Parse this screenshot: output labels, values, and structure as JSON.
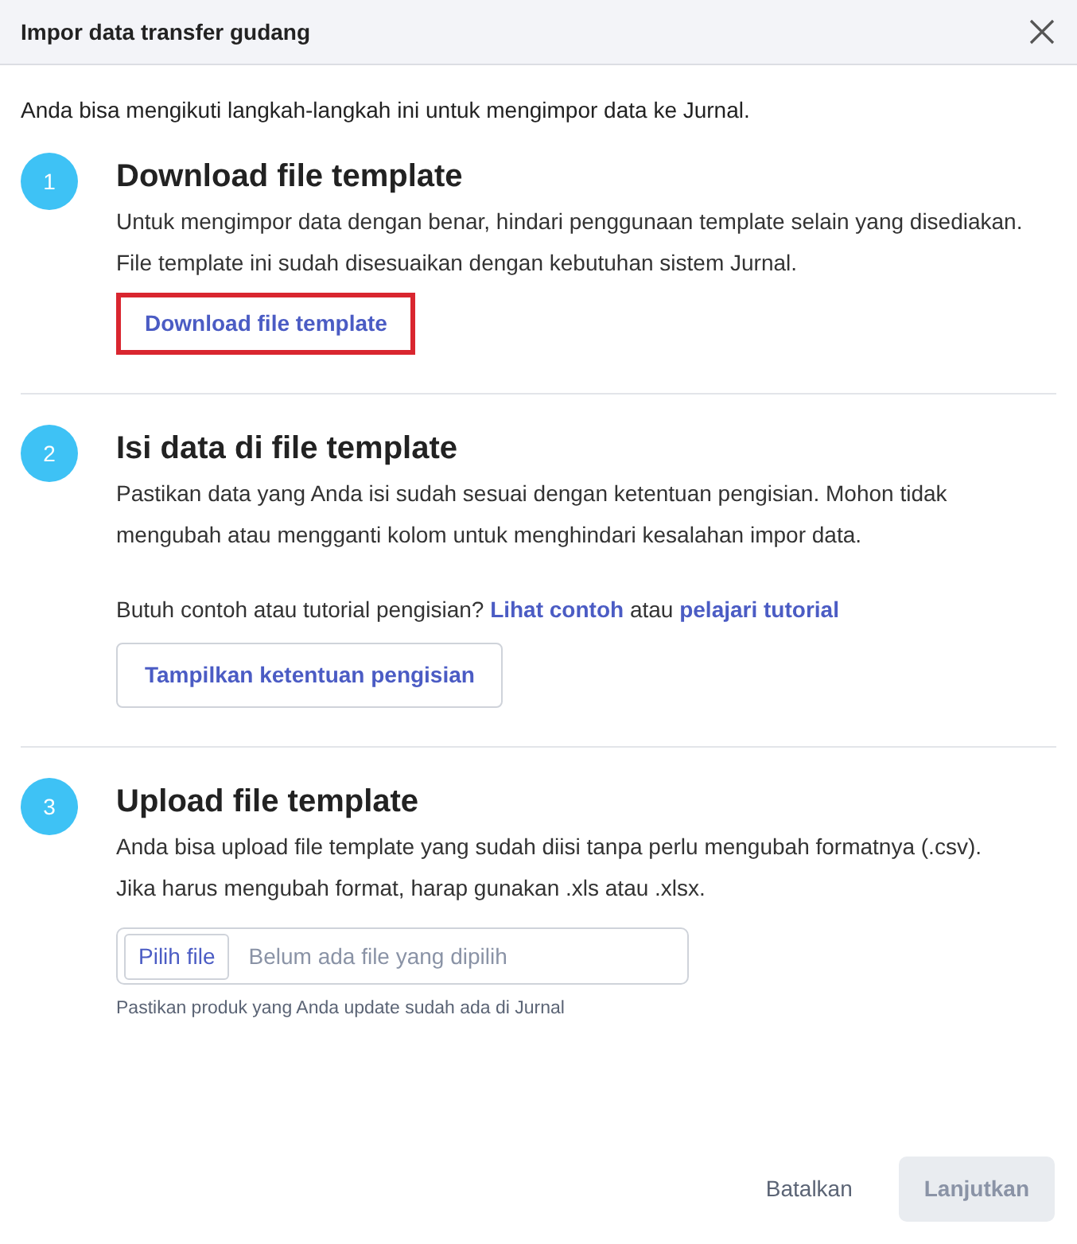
{
  "dialog": {
    "title": "Impor data transfer gudang"
  },
  "intro": "Anda bisa mengikuti langkah-langkah ini untuk mengimpor data ke Jurnal.",
  "steps": [
    {
      "number": "1",
      "title": "Download file template",
      "description": [
        "Untuk mengimpor data dengan benar, hindari penggunaan template selain yang disediakan.",
        "File template ini sudah disesuaikan dengan kebutuhan sistem Jurnal."
      ],
      "button": {
        "label": "Download file template",
        "kind": "link",
        "highlighted": true
      }
    },
    {
      "number": "2",
      "title": "Isi data di file template",
      "description": [
        "Pastikan data yang Anda isi sudah sesuai dengan ketentuan pengisian. Mohon tidak",
        "mengubah atau mengganti kolom untuk menghindari kesalahan impor data."
      ],
      "help": [
        {
          "kind": "text",
          "text": "Butuh contoh atau tutorial pengisian?"
        },
        {
          "kind": "link",
          "text": "Lihat contoh"
        },
        {
          "kind": "text",
          "text": "atau"
        },
        {
          "kind": "link",
          "text": "pelajari tutorial"
        }
      ],
      "button": {
        "label": "Tampilkan ketentuan pengisian",
        "kind": "outline",
        "highlighted": false
      }
    },
    {
      "number": "3",
      "title": "Upload file template",
      "description": [
        "Anda bisa upload file template yang sudah diisi tanpa perlu mengubah formatnya (.csv).",
        "Jika harus mengubah format, harap gunakan .xls atau .xlsx."
      ],
      "file_input": {
        "button": "Pilih file",
        "placeholder": "Belum ada file yang dipilih"
      },
      "hint": "Pastikan produk yang Anda update sudah ada di Jurnal"
    }
  ],
  "footer": {
    "buttons": [
      {
        "label": "Batalkan",
        "disabled": false
      },
      {
        "label": "Lanjutkan",
        "disabled": true
      }
    ]
  }
}
